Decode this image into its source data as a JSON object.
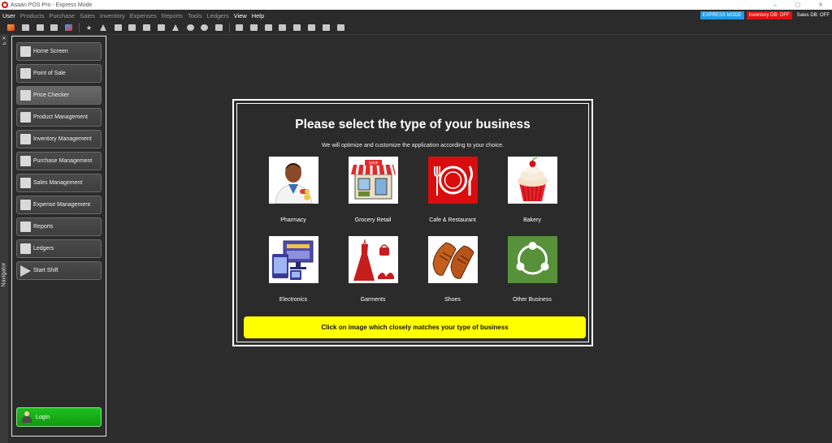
{
  "window": {
    "title": "Asaan POS Pro - Express Mode",
    "controls": [
      "–",
      "▢",
      "✕"
    ]
  },
  "menubar": {
    "items": [
      {
        "label": "User",
        "active": true
      },
      {
        "label": "Products",
        "active": false
      },
      {
        "label": "Purchase",
        "active": false
      },
      {
        "label": "Sales",
        "active": false
      },
      {
        "label": "Inventory",
        "active": false
      },
      {
        "label": "Expenses",
        "active": false
      },
      {
        "label": "Reports",
        "active": false
      },
      {
        "label": "Tools",
        "active": false
      },
      {
        "label": "Ledgers",
        "active": false
      },
      {
        "label": "View",
        "active": true
      },
      {
        "label": "Help",
        "active": true
      }
    ],
    "badges": {
      "mode": "EXPRESS MODE",
      "inventory_db": "Inventory DB: OFF",
      "sales_db": "Sales DB: OFF"
    }
  },
  "navigator": {
    "label": "Navigator",
    "items": [
      {
        "label": "Home Screen",
        "icon": "home-icon"
      },
      {
        "label": "Point of Sale",
        "icon": "pos-terminal-icon"
      },
      {
        "label": "Price Checker",
        "icon": "barcode-icon",
        "selected": true
      },
      {
        "label": "Product Management",
        "icon": "box-icon"
      },
      {
        "label": "Inventory Management",
        "icon": "boxes-icon"
      },
      {
        "label": "Purchase Management",
        "icon": "clipboard-icon"
      },
      {
        "label": "Sales Management",
        "icon": "bar-chart-icon"
      },
      {
        "label": "Expense Management",
        "icon": "wallet-icon"
      },
      {
        "label": "Reports",
        "icon": "report-icon"
      },
      {
        "label": "Ledgers",
        "icon": "ledger-icon"
      },
      {
        "label": "Start Shift",
        "icon": "play-icon"
      }
    ],
    "login": "Login"
  },
  "dialog": {
    "title": "Please select the type of your business",
    "subtitle": "We will optimize and customize the application according to your choice.",
    "businesses": [
      {
        "label": "Pharmacy",
        "icon": "pharmacist-icon"
      },
      {
        "label": "Grocery Retail",
        "icon": "shop-icon"
      },
      {
        "label": "Cafe & Restaurant",
        "icon": "plate-cutlery-icon"
      },
      {
        "label": "Bakery",
        "icon": "cupcake-icon"
      },
      {
        "label": "Electronics",
        "icon": "devices-icon"
      },
      {
        "label": "Garments",
        "icon": "dress-icon"
      },
      {
        "label": "Shoes",
        "icon": "shoes-icon"
      },
      {
        "label": "Other Business",
        "icon": "share-network-icon"
      }
    ],
    "hint": "Click on image which closely matches your type of business"
  },
  "colors": {
    "background": "#2d2d2d",
    "express_badge": "#1e9be6",
    "db_off_badge": "#e01010",
    "login": "#13a813",
    "hint": "#ffff00"
  }
}
